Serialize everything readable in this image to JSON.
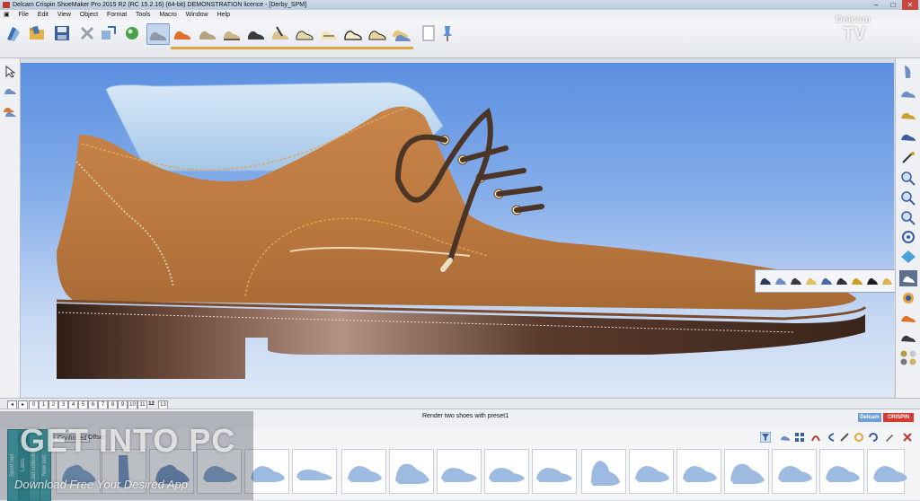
{
  "window": {
    "title": "Delcam Crispin ShoeMaker Pro 2015 R2 (RC 15.2.16)  (64-bit) DEMONSTRATION licence - [Derby_SPM]",
    "minimize": "–",
    "maximize": "□",
    "close": "✕"
  },
  "menu": [
    "File",
    "Edit",
    "View",
    "Object",
    "Format",
    "Tools",
    "Macro",
    "Window",
    "Help"
  ],
  "toolbar": {
    "subicons": "▭ ⟶ ▭    ▭ ⟶ ▭",
    "colors": {
      "accent": "#e2a341",
      "selection": "#c4d6ee"
    }
  },
  "pagination": {
    "pages": [
      "0",
      "1",
      "2",
      "3",
      "4",
      "5",
      "6",
      "7",
      "8",
      "9",
      "10",
      "11",
      "12",
      "13"
    ],
    "current": "12"
  },
  "status": {
    "message": "Render two shoes with preset1",
    "brand_left": "Delcam",
    "brand_right": "CRISPIN"
  },
  "lasts_panel": {
    "vertical_tabs": [
      "Sport last",
      "Lasts",
      "Last collection",
      "New last"
    ],
    "tabs": [
      "Confirmed",
      "Offset"
    ]
  },
  "watermark": {
    "brand": "Delcam",
    "tv": "TV",
    "site": "GET INTO PC",
    "tagline": "Download Free Your Desired App"
  }
}
